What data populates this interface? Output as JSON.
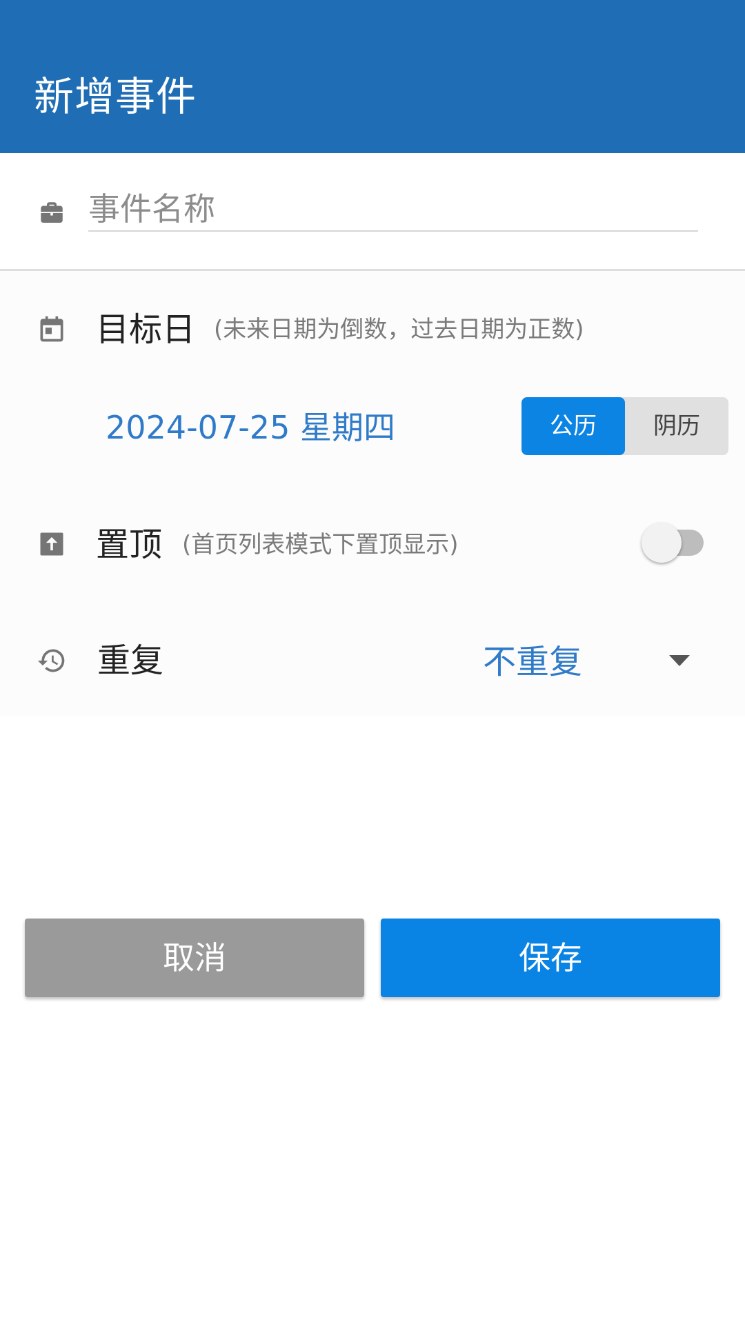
{
  "app_bar": {
    "title": "新增事件",
    "color": "#1f6db4"
  },
  "name_field": {
    "icon": "briefcase-icon",
    "placeholder": "事件名称",
    "value": ""
  },
  "target_date": {
    "icon": "calendar-icon",
    "label": "目标日",
    "hint": "(未来日期为倒数，过去日期为正数)",
    "value": "2024-07-25 星期四",
    "calendar_options": [
      "公历",
      "阴历"
    ],
    "selected_calendar": "公历"
  },
  "pin_top": {
    "icon": "pin-to-top-icon",
    "label": "置顶",
    "hint": "(首页列表模式下置顶显示)",
    "enabled": false
  },
  "repeat": {
    "icon": "history-icon",
    "label": "重复",
    "value": "不重复"
  },
  "buttons": {
    "cancel": "取消",
    "save": "保存"
  },
  "colors": {
    "accent": "#0b84e3",
    "value_text": "#2f7bc9",
    "cancel_bg": "#9a9a9a"
  }
}
